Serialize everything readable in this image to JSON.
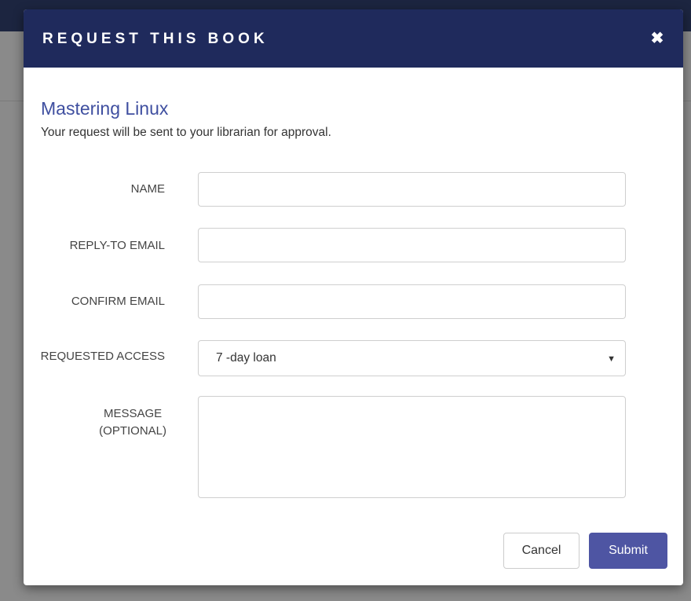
{
  "dialog": {
    "title": "REQUEST THIS BOOK",
    "close_icon": "close-icon",
    "close_glyph": "✖"
  },
  "book": {
    "title": "Mastering Linux",
    "subtitle": "Your request will be sent to your librarian for approval."
  },
  "form": {
    "name_label": "NAME",
    "name_value": "",
    "reply_email_label": "REPLY-TO EMAIL",
    "reply_email_value": "",
    "confirm_email_label": "CONFIRM EMAIL",
    "confirm_email_value": "",
    "access_label": "REQUESTED ACCESS",
    "access_selected": "7 -day loan",
    "access_caret": "▼",
    "message_label_line1": "MESSAGE",
    "message_label_line2": "(OPTIONAL)",
    "message_value": ""
  },
  "actions": {
    "cancel_label": "Cancel",
    "submit_label": "Submit"
  },
  "colors": {
    "header_bg": "#1f2a5c",
    "title_accent": "#3f4fa0",
    "submit_bg": "#4e55a3",
    "overlay": "#8a8a8a"
  }
}
